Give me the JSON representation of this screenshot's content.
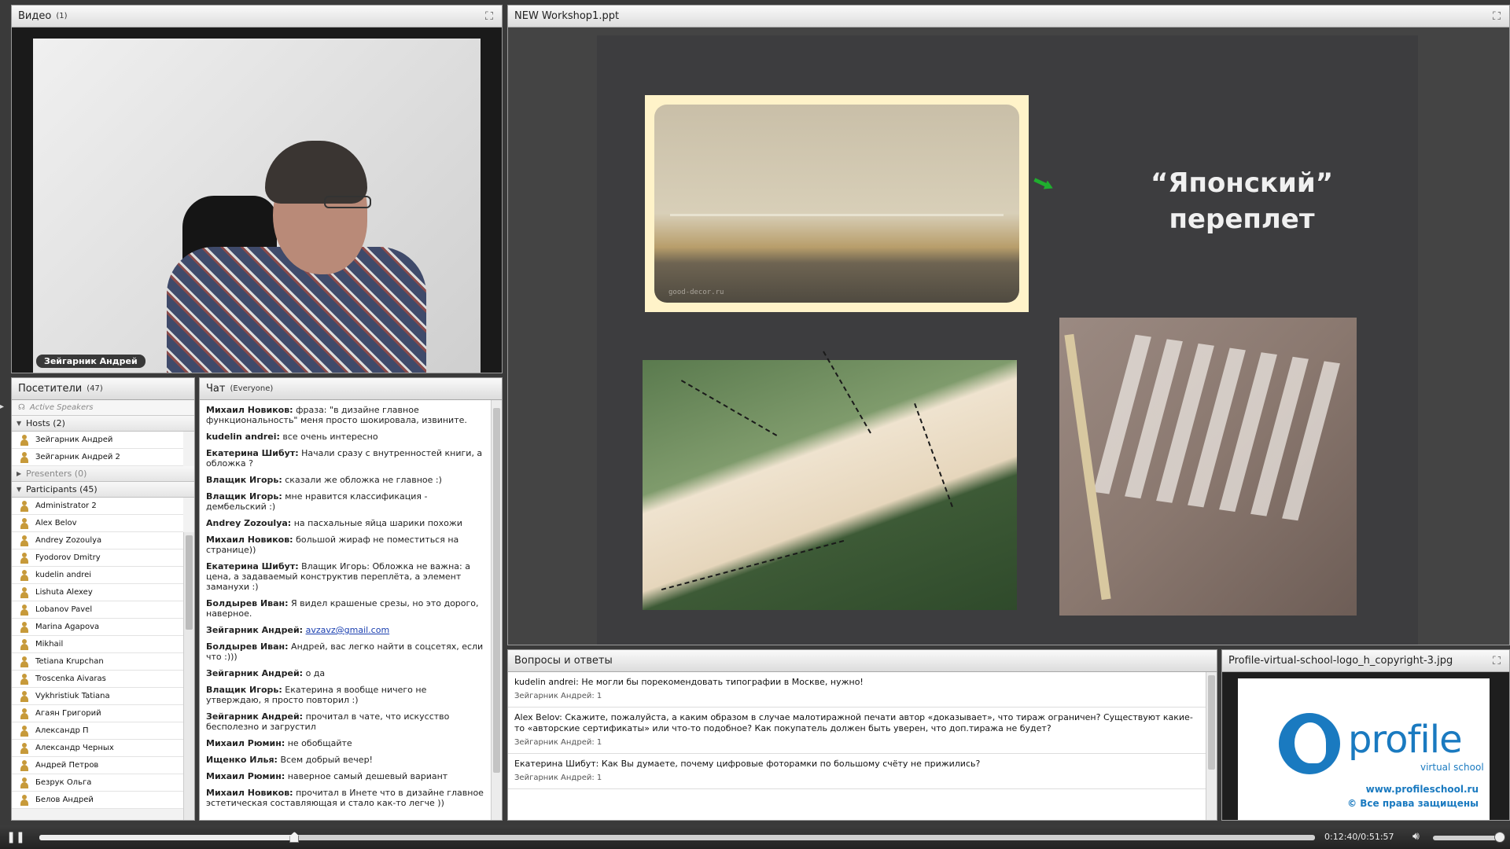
{
  "video": {
    "title": "Видео",
    "count": "(1)",
    "speaker_name": "Зейгарник Андрей"
  },
  "attendees": {
    "title": "Посетители",
    "count": "(47)",
    "active_speakers": "Active Speakers",
    "hosts_label": "Hosts (2)",
    "hosts": [
      "Зейгарник Андрей",
      "Зейгарник Андрей 2"
    ],
    "presenters_label": "Presenters (0)",
    "participants_label": "Participants (45)",
    "participants": [
      "Administrator 2",
      "Alex Belov",
      "Andrey Zozoulya",
      "Fyodorov Dmitry",
      "kudelin andrei",
      "Lishuta Alexey",
      "Lobanov Pavel",
      "Marina Agapova",
      "Mikhail",
      "Tetiana Krupchan",
      "Troscenka Aivaras",
      "Vykhristiuk Tatiana",
      "Агаян Григорий",
      "Александр П",
      "Александр Черных",
      "Андрей Петров",
      "Безрук Ольга",
      "Белов Андрей"
    ]
  },
  "chat": {
    "title": "Чат",
    "scope": "(Everyone)",
    "messages": [
      {
        "author": "Михаил Новиков:",
        "text": " фраза: \"в дизайне главное функциональность\" меня просто шокировала, извините."
      },
      {
        "author": "kudelin andrei:",
        "text": " все очень интересно"
      },
      {
        "author": "Екатерина Шибут:",
        "text": " Начали сразу с внутренностей книги, а обложка ?"
      },
      {
        "author": "Влащик Игорь:",
        "text": " сказали же обложка не главное :)"
      },
      {
        "author": "Влащик Игорь:",
        "text": " мне нравится классификация - дембельский :)"
      },
      {
        "author": "Andrey Zozoulya:",
        "text": " на пасхальные яйца шарики похожи"
      },
      {
        "author": "Михаил Новиков:",
        "text": " большой жираф не поместиться на странице))"
      },
      {
        "author": "Екатерина Шибут:",
        "text": " Влащик Игорь: Обложка не важна: а цена, а задаваемый конструктив переплёта, а элемент заманухи :)"
      },
      {
        "author": "Болдырев Иван:",
        "text": " Я видел крашеные срезы, но это дорого, наверное."
      },
      {
        "author": "Зейгарник Андрей:",
        "text": " ",
        "link": "avzavz@gmail.com"
      },
      {
        "author": "Болдырев Иван:",
        "text": " Андрей, вас легко найти в соцсетях, если что :)))"
      },
      {
        "author": "Зейгарник Андрей:",
        "text": " о да"
      },
      {
        "author": "Влащик Игорь:",
        "text": " Екатерина я вообще ничего не утверждаю, я просто повторил :)"
      },
      {
        "author": "Зейгарник Андрей:",
        "text": " прочитал в чате, что искусство бесполезно и загрустил"
      },
      {
        "author": "Михаил Рюмин:",
        "text": " не обобщайте"
      },
      {
        "author": "Ищенко Илья:",
        "text": " Всем добрый вечер!"
      },
      {
        "author": "Михаил Рюмин:",
        "text": " наверное самый дешевый вариант"
      },
      {
        "author": "Михаил Новиков:",
        "text": " прочитал в Инете что в дизайне главное эстетическая составляющая и стало как-то легче ))"
      }
    ]
  },
  "share": {
    "title": "NEW Workshop1.ppt",
    "slide_title_line1": "“Японский”",
    "slide_title_line2": "переплет",
    "watermark": "good-decor.ru"
  },
  "qa": {
    "title": "Вопросы и ответы",
    "items": [
      {
        "q": "kudelin andrei: Не могли бы порекомендовать типографии в Москве, нужно!",
        "a": "Зейгарник Андрей: 1"
      },
      {
        "q": "Alex Belov: Скажите, пожалуйста, а каким образом в случае малотиражной печати автор «доказывает», что тираж ограничен? Существуют какие-то «авторские сертификаты» или что-то подобное? Как покупатель должен быть уверен, что доп.тиража не будет?",
        "a": "Зейгарник Андрей: 1"
      },
      {
        "q": "Екатерина Шибут: Как Вы думаете, почему цифровые фоторамки по большому счёту не прижились?",
        "a": "Зейгарник Андрей: 1"
      }
    ]
  },
  "logo_pod": {
    "title": "Profile-virtual-school-logo_h_copyright-3.jpg",
    "brand": "profile",
    "sub": "virtual school",
    "url": "www.profileschool.ru",
    "copyright": "© Все права защищены",
    "brand_color": "#1a7ac0"
  },
  "playback": {
    "time": "0:12:40/0:51:57",
    "progress_fraction": 0.2
  }
}
